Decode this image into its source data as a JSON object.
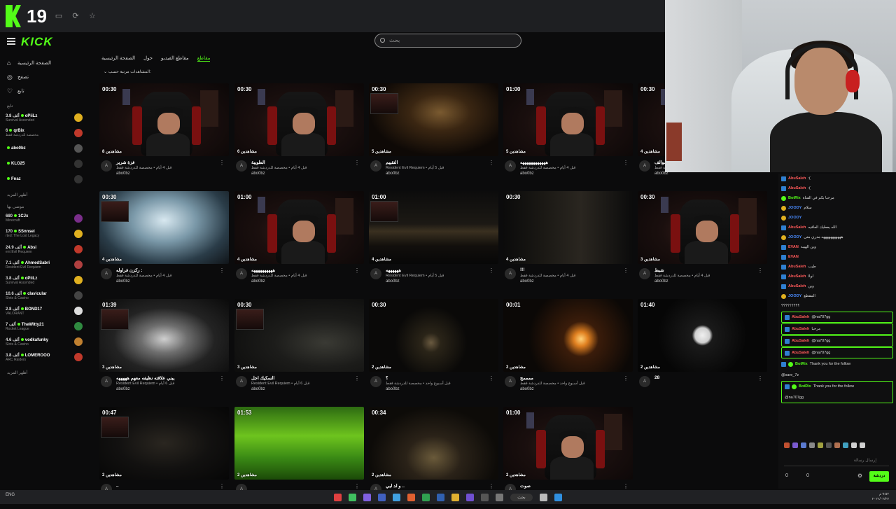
{
  "topbar": {
    "counter": "19"
  },
  "brand": {
    "logo": "KICK"
  },
  "search": {
    "placeholder": "بحث"
  },
  "sidebar": {
    "nav": [
      {
        "label": "الصفحة الرئيسية",
        "icon": "home-icon"
      },
      {
        "label": "تصفح",
        "icon": "compass-icon"
      },
      {
        "label": "تابع",
        "icon": "heart-icon"
      }
    ],
    "following_header": "تابع",
    "following": [
      {
        "count": "3.8 ألف",
        "name": "oPiiLz",
        "game": "Survival Ascended",
        "color": "#e0b020"
      },
      {
        "count": "6",
        "name": "qrBix",
        "game": "مخصصة للدردشة فقط",
        "color": "#c0392b"
      },
      {
        "count": "",
        "name": "abo0bz",
        "game": "",
        "color": "#555"
      },
      {
        "count": "",
        "name": "KLO25",
        "game": "",
        "color": "#333"
      },
      {
        "count": "",
        "name": "Fnaz",
        "game": "",
        "color": "#333"
      }
    ],
    "show_more": "أظهر المزيد",
    "recommended_header": "موصى بها",
    "recommended": [
      {
        "count": "680",
        "name": "1CJx",
        "game": "Minecraft",
        "color": "#7a2e8a"
      },
      {
        "count": "170",
        "name": "SSnnsei",
        "game": "rted: The Lost Legacy",
        "color": "#e0b020"
      },
      {
        "count": "24.9 ألف",
        "name": "Absi",
        "game": "ent Evil Requiem",
        "color": "#c0392b"
      },
      {
        "count": "7.1 ألف",
        "name": "AhmedSabri",
        "game": "Resident Evil Requiem",
        "color": "#b04040"
      },
      {
        "count": "3.8 ألف",
        "name": "oPiiLz",
        "game": "Survival Ascended",
        "color": "#e0b020"
      },
      {
        "count": "10.6 ألف",
        "name": "clavicular",
        "game": "Slots & Casino",
        "color": "#444"
      },
      {
        "count": "2.8 ألف",
        "name": "BOND17",
        "game": "VALORANT",
        "color": "#ddd"
      },
      {
        "count": "7 ألف",
        "name": "TheWitty21",
        "game": "Rocket League",
        "color": "#2f8a40"
      },
      {
        "count": "4.6 ألف",
        "name": "vodkafunky",
        "game": "Slots & Casino",
        "color": "#c08030"
      },
      {
        "count": "3.8 ألف",
        "name": "LOMEROOO",
        "game": "ARC Raiders",
        "color": "#c0392b"
      }
    ],
    "show_more_2": "أظهر المزيد"
  },
  "tabs": {
    "items": [
      "الصفحة الرئيسية",
      "حول",
      "مقاطع الفيديو",
      "مقاطع"
    ],
    "active_index": 3
  },
  "sort": {
    "label": "مرتبة حسب:",
    "value": "المشاهدات"
  },
  "clips": [
    {
      "dur": "00:30",
      "views": "8 مشاهدين",
      "title": "فزة شرير",
      "desc": "قبل 4 أيام • مخصصة للدردشة فقط",
      "user": "abo0bz",
      "art": "room"
    },
    {
      "dur": "00:30",
      "views": "6 مشاهدين",
      "title": "الطويبة",
      "desc": "قبل 4 أيام • مخصصة للدردشة فقط",
      "user": "abo0bz",
      "art": "room"
    },
    {
      "dur": "00:30",
      "views": "5 مشاهدين",
      "title": "التقييم",
      "desc": "Resident Evil Requiem • قبل 5 أيام",
      "user": "abo0bz",
      "art": "blonde"
    },
    {
      "dur": "01:00",
      "views": "5 مشاهدين",
      "title": "ههههههههههههه",
      "desc": "قبل 4 أيام • مخصصة للدردشة فقط",
      "user": "abo0bz",
      "art": "room"
    },
    {
      "dur": "00:30",
      "views": "4 مشاهدين",
      "title": "سوالف",
      "desc": "قبل 4 أيام • مخصصة للدردشة فقط",
      "user": "abo0bz",
      "art": "room"
    },
    {
      "dur": "00:30",
      "views": "4 مشاهدين",
      "title": "ركزن فراوله :",
      "desc": "قبل 4 أيام • مخصصة للدردشة فقط",
      "user": "abo0bz",
      "art": "map"
    },
    {
      "dur": "01:00",
      "views": "4 مشاهدين",
      "title": "ههههههههههه",
      "desc": "قبل 4 أيام • مخصصة للدردشة فقط",
      "user": "abo0bz",
      "art": "room"
    },
    {
      "dur": "01:00",
      "views": "4 مشاهدين",
      "title": "ههههههه",
      "desc": "Resident Evil Requiem • قبل 5 أيام",
      "user": "abo0bz",
      "art": "kitchen"
    },
    {
      "dur": "00:30",
      "views": "4 مشاهدين",
      "title": "!!!",
      "desc": "قبل 4 أيام • مخصصة للدردشة فقط",
      "user": "abo0bz",
      "art": "cabinet"
    },
    {
      "dur": "00:30",
      "views": "3 مشاهدين",
      "title": "شبط",
      "desc": "قبل 4 أيام • مخصصة للدردشة فقط",
      "user": "abo0bz",
      "art": "room"
    },
    {
      "dur": "01:39",
      "views": "3 مشاهدين",
      "title": "يبني علاقته نظيفه معهم هههههه",
      "desc": "Resident Evil Requiem • قبل 6 أيام",
      "user": "abo0bz",
      "art": "house"
    },
    {
      "dur": "00:30",
      "views": "3 مشاهدين",
      "title": "السكيك اجل",
      "desc": "Resident Evil Requiem • قبل 6 أيام",
      "user": "abo0bz",
      "art": "hand"
    },
    {
      "dur": "00:30",
      "views": "2 مشاهدين",
      "title": "؟",
      "desc": "قبل أسبوع واحد • مخصصة للدردشة فقط",
      "user": "abo0bz",
      "art": "lantern"
    },
    {
      "dur": "00:01",
      "views": "2 مشاهدين",
      "title": "ممممج",
      "desc": "قبل أسبوع واحد • مخصصة للدردشة فقط",
      "user": "abo0bz",
      "art": "fire"
    },
    {
      "dur": "01:40",
      "views": "2 مشاهدين",
      "title": "28",
      "desc": "",
      "user": "",
      "art": "moon"
    },
    {
      "dur": "00:47",
      "views": "2 مشاهدين",
      "title": "..",
      "desc": "",
      "user": "",
      "art": "dark"
    },
    {
      "dur": "01:53",
      "views": "2 مشاهدين",
      "title": "",
      "desc": "",
      "user": "",
      "art": "green"
    },
    {
      "dur": "00:34",
      "views": "2 مشاهدين",
      "title": "و لد لبي ..",
      "desc": "",
      "user": "",
      "art": "hall"
    },
    {
      "dur": "01:00",
      "views": "2 مشاهدين",
      "title": "صوت",
      "desc": "",
      "user": "",
      "art": "room"
    }
  ],
  "chat": {
    "messages": [
      {
        "user": "AbuSaleh",
        "text": ":(",
        "badge": "b",
        "ucol": ""
      },
      {
        "user": "AbuSaleh",
        "text": ":(",
        "badge": "b",
        "ucol": ""
      },
      {
        "user": "BotRix",
        "text": "مرحبا بكم في القناة",
        "badge": "g",
        "ucol": "g"
      },
      {
        "user": "JOODY",
        "text": "سلام",
        "badge": "y",
        "ucol": "b"
      },
      {
        "user": "JOODY",
        "text": "",
        "badge": "y",
        "ucol": "b"
      },
      {
        "user": "AbuSaleh",
        "text": "الله يعطيك العافيه",
        "badge": "b",
        "ucol": ""
      },
      {
        "user": "JOODY",
        "text": "هههههههههههه مدري متى",
        "badge": "y",
        "ucol": "b"
      },
      {
        "user": "EVAN",
        "text": "وين الهيبه",
        "badge": "b",
        "ucol": ""
      },
      {
        "user": "EVAN",
        "text": "",
        "badge": "b",
        "ucol": ""
      },
      {
        "user": "AbuSaleh",
        "text": "طيب",
        "badge": "b",
        "ucol": ""
      },
      {
        "user": "AbuSaleh",
        "text": "لولا",
        "badge": "b",
        "ucol": ""
      },
      {
        "user": "AbuSaleh",
        "text": "وين",
        "badge": "b",
        "ucol": ""
      },
      {
        "user": "JOODY",
        "text": "المقطع",
        "badge": "y",
        "ucol": "b"
      },
      {
        "user": "",
        "text": "؟؟؟؟؟؟؟؟؟",
        "badge": "",
        "ucol": ""
      }
    ],
    "highlighted": [
      {
        "user": "AbuSaleh",
        "text": "@na707gg"
      },
      {
        "user": "AbuSaleh",
        "text": "مرحبا"
      },
      {
        "user": "AbuSaleh",
        "text": "@na707gg"
      },
      {
        "user": "AbuSaleh",
        "text": "@na707gg"
      }
    ],
    "bot1": {
      "user": "BotRix",
      "text": "Thank you for the follow",
      "mention": "@sare_7z"
    },
    "bot2": {
      "user": "BotRix",
      "text": "Thank you for the follow",
      "mention": "@na707gg"
    },
    "input_placeholder": "إرسال رسالة",
    "send_label": "دردشة",
    "points": "0",
    "points2": "0"
  },
  "taskbar": {
    "lang": "ENG",
    "search_label": "بحث",
    "clock": "٩:٥٢ م",
    "date": "٢٠٢٦/٠٢/٢٧"
  }
}
